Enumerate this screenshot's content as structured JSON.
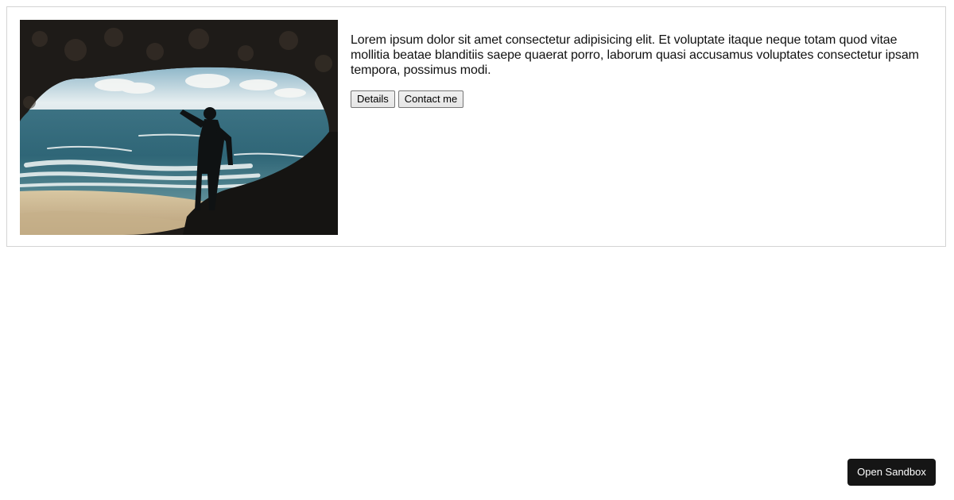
{
  "card": {
    "description": "Lorem ipsum dolor sit amet consectetur adipisicing elit. Et voluptate itaque neque totam quod vitae mollitia beatae blanditiis saepe quaerat porro, laborum quasi accusamus voluptates consectetur ipsam tempora, possimus modi.",
    "buttons": [
      {
        "label": "Details"
      },
      {
        "label": "Contact me"
      }
    ]
  },
  "footer": {
    "sandbox_label": "Open Sandbox"
  },
  "colors": {
    "card_border": "#d4d4d4",
    "sandbox_bg": "#151515",
    "sandbox_text": "#ffffff"
  },
  "image": {
    "subject": "person silhouette pointing out of a sea cave toward the ocean"
  }
}
